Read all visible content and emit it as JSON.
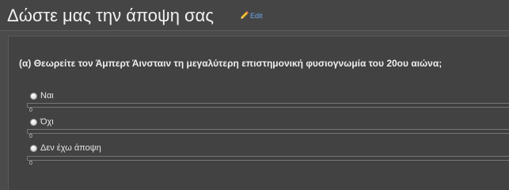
{
  "page": {
    "title": "Δώστε μας την άποψη σας",
    "edit_label": "Edit"
  },
  "poll": {
    "question": "(α) Θεωρείτε τον Άμπερτ Άινσταιν τη μεγαλύτερη επιστημονική φυσιογνωμία του 20ου αιώνα;",
    "options": [
      {
        "label": "Ναι",
        "votes": "0",
        "fraction": 0
      },
      {
        "label": "Όχι",
        "votes": "0",
        "fraction": 0
      },
      {
        "label": "Δεν έχω άποψη",
        "votes": "0",
        "fraction": 0
      }
    ]
  },
  "icons": {
    "edit": "pencil-icon",
    "option": "radio-icon"
  },
  "colors": {
    "background": "#4b4b4b",
    "header": "#454545",
    "panel": "#424242",
    "link": "#6fa8e8"
  }
}
